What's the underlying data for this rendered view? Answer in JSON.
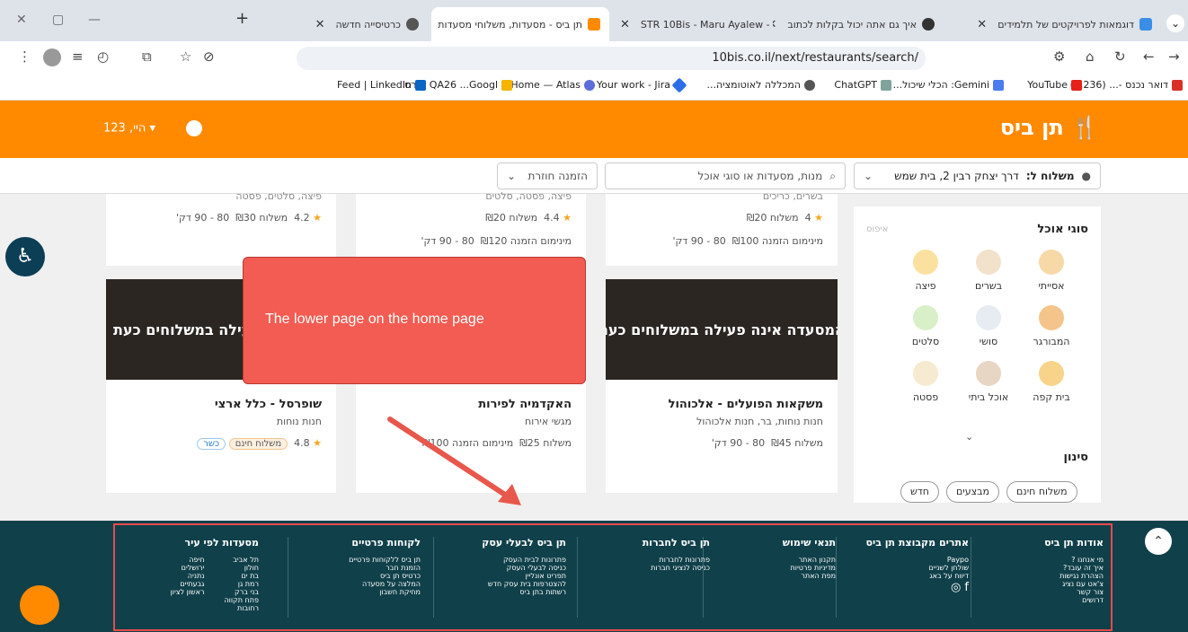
{
  "browser": {
    "tabs": [
      {
        "title": "דוגמאות לפרויקטים של תלמידים",
        "active": false
      },
      {
        "title": "איך גם אתה יכול בקלות לכתוב",
        "active": false
      },
      {
        "title": "STR 10Bis - Maru Ayalew - mar",
        "active": false
      },
      {
        "title": "תן ביס - מסעדות, משלוחי מסעדות",
        "active": true
      },
      {
        "title": "כרטיסייה חדשה",
        "active": false
      }
    ],
    "new_tab": "+",
    "url": "10bis.co.il/next/restaurants/search/",
    "bookmarks": [
      "דואר נכנס -... (1,236)",
      "YouTube",
      "Gemini: הכלי שיכול...",
      "ChatGPT",
      "המכללה לאוטומציה...",
      "Your work - Jira",
      "Home — Atlas",
      "קורס QA26 ...Googl",
      "Feed | LinkedIn"
    ]
  },
  "site": {
    "logo": "תן ביס",
    "user_greeting": "היי, 123",
    "delivery_label": "משלוח ל:",
    "delivery_address": "דרך יצחק רבין 2, בית שמש",
    "search_placeholder": "מנות, מסעדות או סוגי אוכל",
    "reorder": "הזמנה חוזרת"
  },
  "cards_top": [
    {
      "line1": "פיצה, סלטים, פסטה",
      "rating": "4.2",
      "delivery": "משלוח ₪30",
      "time": "80 - 90 דק'"
    },
    {
      "line1": "פיצה, פסטה, סלטים",
      "rating": "4.4",
      "delivery": "משלוח ₪20",
      "min": "מינימום הזמנה ₪120",
      "time": "80 - 90 דק'"
    },
    {
      "line1": "בשרים, כריכים",
      "rating": "4",
      "delivery": "משלוח ₪20",
      "min": "מינימום הזמנה ₪100",
      "time": "80 - 90 דק'"
    }
  ],
  "cards": [
    {
      "banner": "המסעדה אינה פעילה במשלוחים כעת",
      "title": "משקאות הפועלים - אלכוהול",
      "sub": "חנות נוחות, בר, חנות אלכוהול",
      "delivery": "משלוח ₪45",
      "time": "80 - 90 דק'"
    },
    {
      "banner": "",
      "title": "האקדמיה לפירות",
      "sub": "מגשי אירוח",
      "delivery": "משלוח ₪25",
      "min": "מינימום הזמנה ₪100"
    },
    {
      "banner": "פעילה במשלוחים כעת",
      "title": "שופרסל - כלל ארצי",
      "sub": "חנות נוחות",
      "rating": "4.8",
      "free": "משלוח חינם",
      "kosher": "כשר"
    }
  ],
  "sidebar": {
    "title": "סוגי אוכל",
    "reset": "איפוס",
    "food_types": [
      {
        "label": "אסייתי",
        "icon": "bowl-icon",
        "color": "#f7d9a8"
      },
      {
        "label": "בשרים",
        "icon": "skewer-icon",
        "color": "#f2e2cc"
      },
      {
        "label": "פיצה",
        "icon": "pizza-icon",
        "color": "#fbe1a0"
      },
      {
        "label": "המבורגר",
        "icon": "burger-icon",
        "color": "#f5c48a"
      },
      {
        "label": "סושי",
        "icon": "sushi-icon",
        "color": "#e6ecf2"
      },
      {
        "label": "סלטים",
        "icon": "salad-icon",
        "color": "#d8efc8"
      },
      {
        "label": "בית קפה",
        "icon": "coffee-icon",
        "color": "#f7d48a"
      },
      {
        "label": "אוכל ביתי",
        "icon": "home-food-icon",
        "color": "#e8d6c4"
      },
      {
        "label": "פסטה",
        "icon": "pasta-icon",
        "color": "#f6ead0"
      }
    ],
    "filter_title": "סינון",
    "filters": [
      "משלוח חינם",
      "מבצעים",
      "חדש"
    ]
  },
  "callout": "The lower page on the home page",
  "footer": {
    "columns": [
      {
        "title": "אודות תן ביס",
        "items": [
          "מי אנחנו ?",
          "איך זה עובד?",
          "הצהרת נגישות",
          "צ'אט עם נציג",
          "צור קשר",
          "דרושים"
        ]
      },
      {
        "title": "אתרים מקבוצת תן ביס",
        "items": [
          "Paypo",
          "שולחן לשניים",
          "דיווח על באג"
        ]
      },
      {
        "title": "תנאי שימוש",
        "items": [
          "תקנון האתר",
          "מדיניות פרטיות",
          "מפת האתר"
        ]
      },
      {
        "title": "תן ביס לחברות",
        "items": [
          "פתרונות לחברות",
          "כניסה לנציגי חברות"
        ]
      },
      {
        "title": "תן ביס לבעלי עסק",
        "items": [
          "פתרונות לבית העסק",
          "כניסה לבעלי העסק",
          "תפריט אונליין",
          "להצטרפות בית עסק חדש",
          "רשתות בתן ביס"
        ]
      },
      {
        "title": "לקוחות פרטיים",
        "items": [
          "תן ביס ללקוחות פרטיים",
          "הזמנת חבר",
          "כרטיס תן ביס",
          "המלצה על מסעדה",
          "מחיקת חשבון"
        ]
      },
      {
        "title": "מסעדות לפי עיר",
        "items": [
          "תל אביב",
          "חולון",
          "בת ים",
          "רמת גן",
          "בני ברק",
          "פתח תקווה",
          "רחובות"
        ],
        "items2": [
          "חיפה",
          "ירושלים",
          "נתניה",
          "גבעתיים",
          "ראשון לציון"
        ]
      }
    ]
  }
}
